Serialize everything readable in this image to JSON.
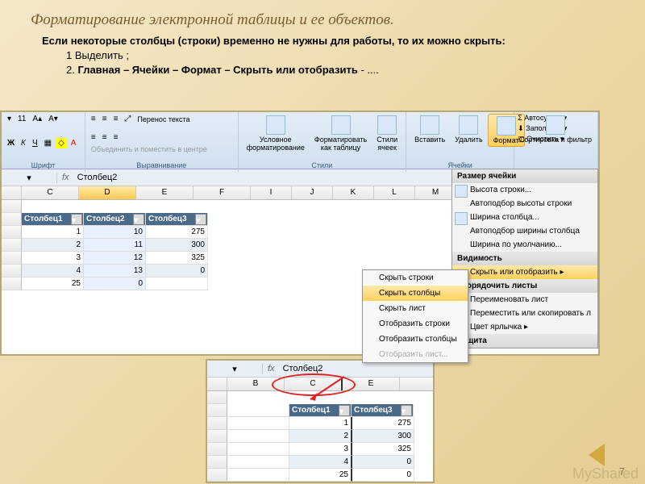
{
  "title": "Форматирование электронной таблицы и ее объектов.",
  "desc_bold": "Если некоторые столбцы (строки) временно не нужны для работы, то их можно скрыть:",
  "desc_l1": "1 Выделить ;",
  "desc_l2a": "2. ",
  "desc_l2b": "Главная – Ячейки – Формат – Скрыть или отобразить",
  "desc_l2c": " - ....",
  "ribbon": {
    "font_size": "11",
    "font_group": "Шрифт",
    "align_group": "Выравнивание",
    "wrap": "Перенос текста",
    "merge": "Объединить и поместить в центре",
    "styles_group": "Стили",
    "cond": "Условное форматирование",
    "astable": "Форматировать как таблицу",
    "cellstyles": "Стили ячеек",
    "cells_group": "Ячейки",
    "insert": "Вставить",
    "delete": "Удалить",
    "format": "Формат",
    "autosum": "Автосумма",
    "fill": "Заполнить",
    "clear": "Очистить",
    "sort": "Сортировка и фильтр"
  },
  "menu": {
    "h1": "Размер ячейки",
    "i1": "Высота строки...",
    "i2": "Автоподбор высоты строки",
    "i3": "Ширина столбца...",
    "i4": "Автоподбор ширины столбца",
    "i5": "Ширина по умолчанию...",
    "h2": "Видимость",
    "i6": "Скрыть или отобразить",
    "h3": "Упорядочить листы",
    "i7": "Переименовать лист",
    "i8": "Переместить или скопировать л",
    "i9": "Цвет ярлычка",
    "h4": "Защита"
  },
  "context": {
    "c1": "Скрыть строки",
    "c2": "Скрыть столбцы",
    "c3": "Скрыть лист",
    "c4": "Отобразить строки",
    "c5": "Отобразить столбцы",
    "c6": "Отобразить лист..."
  },
  "fbar": {
    "fx": "fx",
    "val": "Столбец2"
  },
  "cols1": [
    "",
    "C",
    "D",
    "E",
    "F",
    "I",
    "J",
    "K",
    "L",
    "M"
  ],
  "cols2": [
    "",
    "B",
    "C",
    "E"
  ],
  "table1": {
    "h1": "Столбец1",
    "h2": "Столбец2",
    "h3": "Столбец3",
    "rows": [
      [
        "1",
        "10",
        "275"
      ],
      [
        "2",
        "11",
        "300"
      ],
      [
        "3",
        "12",
        "325"
      ],
      [
        "4",
        "13",
        "0"
      ],
      [
        "25",
        "0",
        ""
      ]
    ]
  },
  "table2": {
    "h1": "Столбец1",
    "h2": "Столбец3",
    "rows": [
      [
        "1",
        "275"
      ],
      [
        "2",
        "300"
      ],
      [
        "3",
        "325"
      ],
      [
        "4",
        "0"
      ],
      [
        "25",
        "0"
      ]
    ]
  },
  "pagenum": "7",
  "watermark": "MyShared"
}
